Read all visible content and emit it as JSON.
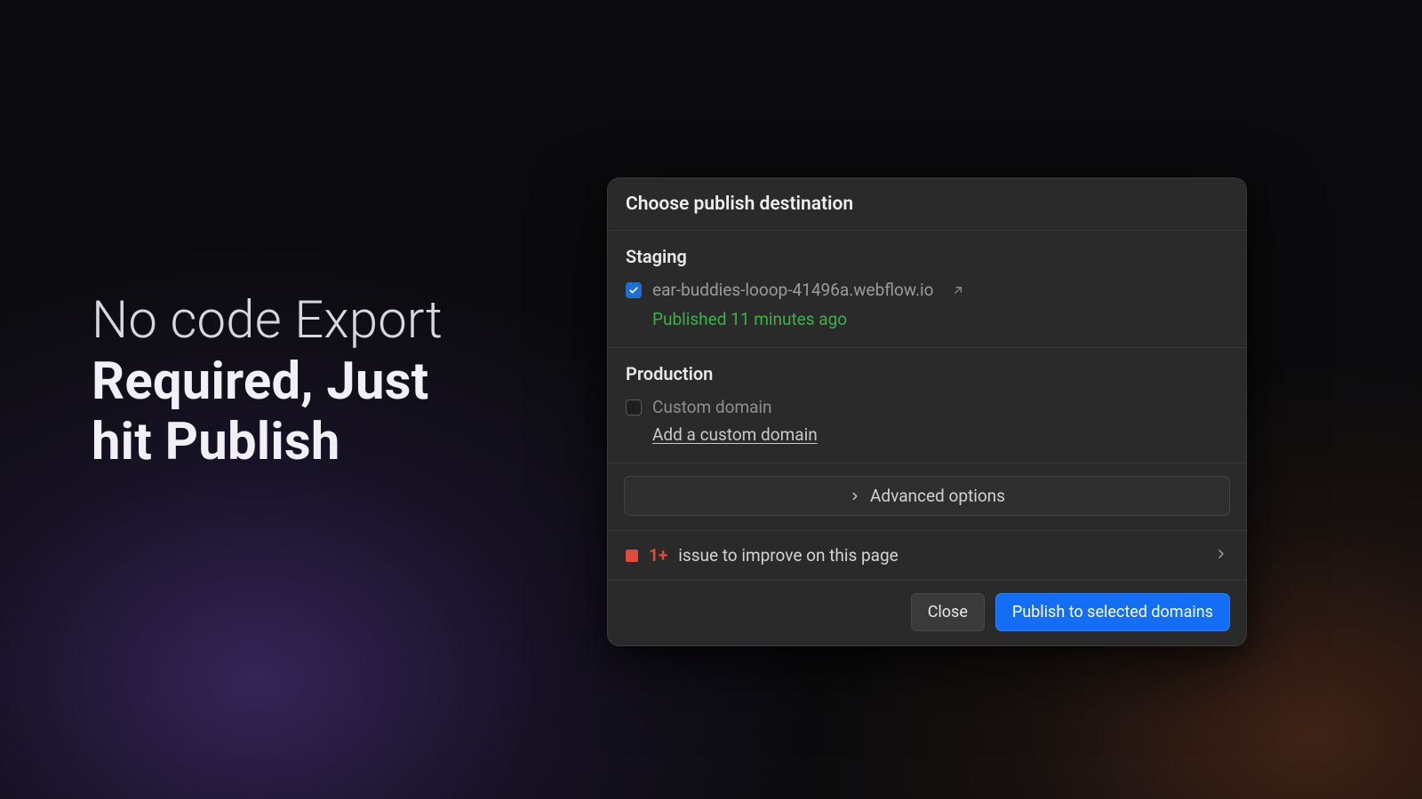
{
  "headline": {
    "line1": "No code Export",
    "line2": "Required, Just",
    "line3": "hit Publish"
  },
  "dialog": {
    "title": "Choose publish destination",
    "staging": {
      "label": "Staging",
      "domain": "ear-buddies-looop-41496a.webflow.io",
      "checked": true,
      "status": "Published 11 minutes ago"
    },
    "production": {
      "label": "Production",
      "custom_domain_label": "Custom domain",
      "checked": false,
      "add_link": "Add a custom domain"
    },
    "advanced_label": "Advanced options",
    "issues": {
      "count": "1+",
      "text": "issue to improve on this page"
    },
    "buttons": {
      "close": "Close",
      "publish": "Publish to selected domains"
    }
  },
  "colors": {
    "accent_blue": "#146ef5",
    "status_green": "#3fae4c",
    "issue_red": "#e04a3a"
  }
}
